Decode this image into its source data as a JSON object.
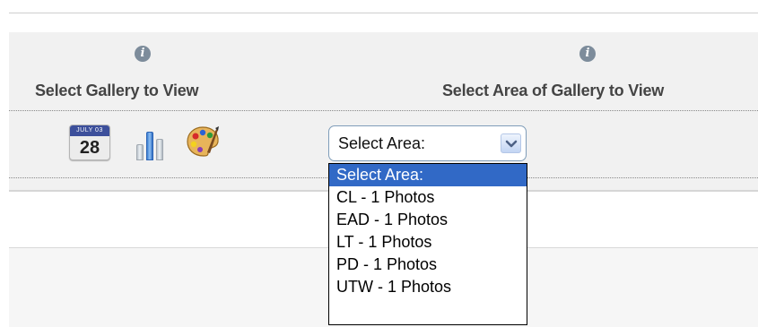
{
  "columns": {
    "gallery": {
      "heading": "Select Gallery to View",
      "info_icon": "info-icon"
    },
    "area": {
      "heading": "Select Area of Gallery to View",
      "info_icon": "info-icon"
    }
  },
  "gallery_icons": {
    "calendar": {
      "icon": "calendar-icon",
      "month": "JULY 03",
      "day": "28"
    },
    "chart": {
      "icon": "bar-chart-icon"
    },
    "palette": {
      "icon": "paint-palette-icon"
    }
  },
  "area_select": {
    "value": "Select Area:",
    "options": [
      "Select Area:",
      "CL - 1 Photos",
      "EAD - 1 Photos",
      "LT - 1 Photos",
      "PD - 1 Photos",
      "UTW - 1 Photos"
    ],
    "highlighted_index": 0
  },
  "colors": {
    "highlight": "#3169c6",
    "panel": "#f1f1f1",
    "heading_text": "#444444"
  }
}
